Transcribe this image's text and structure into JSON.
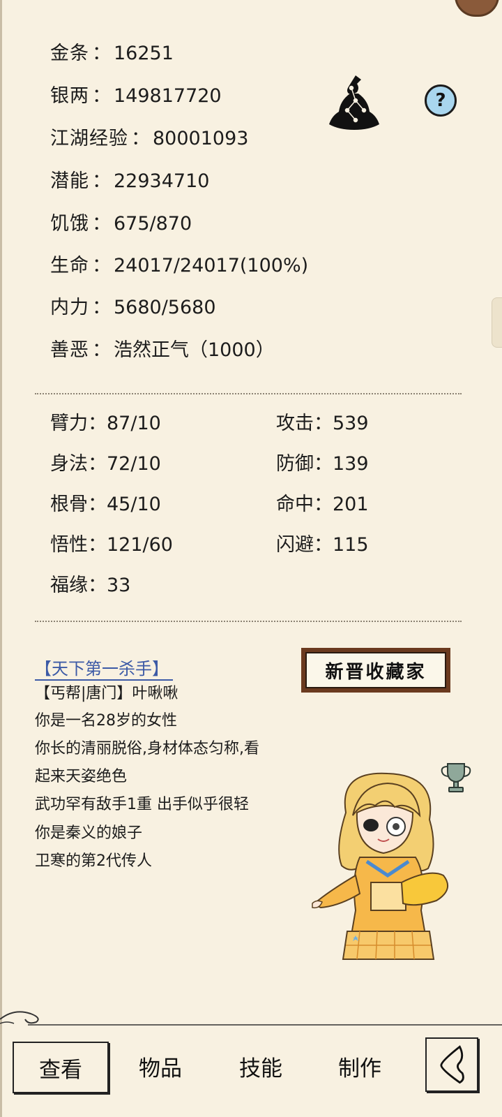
{
  "resources": [
    {
      "key": "金条",
      "value": "16251"
    },
    {
      "key": "银两",
      "value": "149817720"
    },
    {
      "key": "江湖经验",
      "value": "80001093"
    },
    {
      "key": "潜能",
      "value": "22934710"
    },
    {
      "key": "饥饿",
      "value": "675/870"
    },
    {
      "key": "生命",
      "value": "24017/24017(100%)"
    },
    {
      "key": "内力",
      "value": "5680/5680"
    },
    {
      "key": "善恶",
      "value": "浩然正气（1000）"
    }
  ],
  "attributes_left": [
    {
      "key": "臂力",
      "value": "87/10"
    },
    {
      "key": "身法",
      "value": "72/10"
    },
    {
      "key": "根骨",
      "value": "45/10"
    },
    {
      "key": "悟性",
      "value": "121/60"
    },
    {
      "key": "福缘",
      "value": "33"
    }
  ],
  "attributes_right": [
    {
      "key": "攻击",
      "value": "539"
    },
    {
      "key": "防御",
      "value": "139"
    },
    {
      "key": "命中",
      "value": "201"
    },
    {
      "key": "闪避",
      "value": "115"
    }
  ],
  "separator": "：",
  "help_symbol": "?",
  "profile": {
    "title_link": "【天下第一杀手】",
    "plaque_text": "新晋收藏家",
    "bio_lines": [
      "【丐帮|唐门】叶啾啾",
      "你是一名28岁的女性",
      "你长的清丽脱俗,身材体态匀称,看",
      "起来天姿绝色",
      "武功罕有敌手1重 出手似乎很轻",
      "你是秦义的娘子",
      "卫寒的第2代传人"
    ]
  },
  "nav": {
    "view": "查看",
    "items": "物品",
    "skills": "技能",
    "craft": "制作"
  },
  "icons": {
    "meditate": "meditating-figure-icon",
    "help": "help-icon",
    "trophy": "trophy-icon",
    "back": "back-arrow-icon"
  },
  "colors": {
    "background": "#f8f1e1",
    "link": "#3c5aa6",
    "help_bg": "#a9d6ee",
    "plaque_frame": "#6b3a1f"
  }
}
